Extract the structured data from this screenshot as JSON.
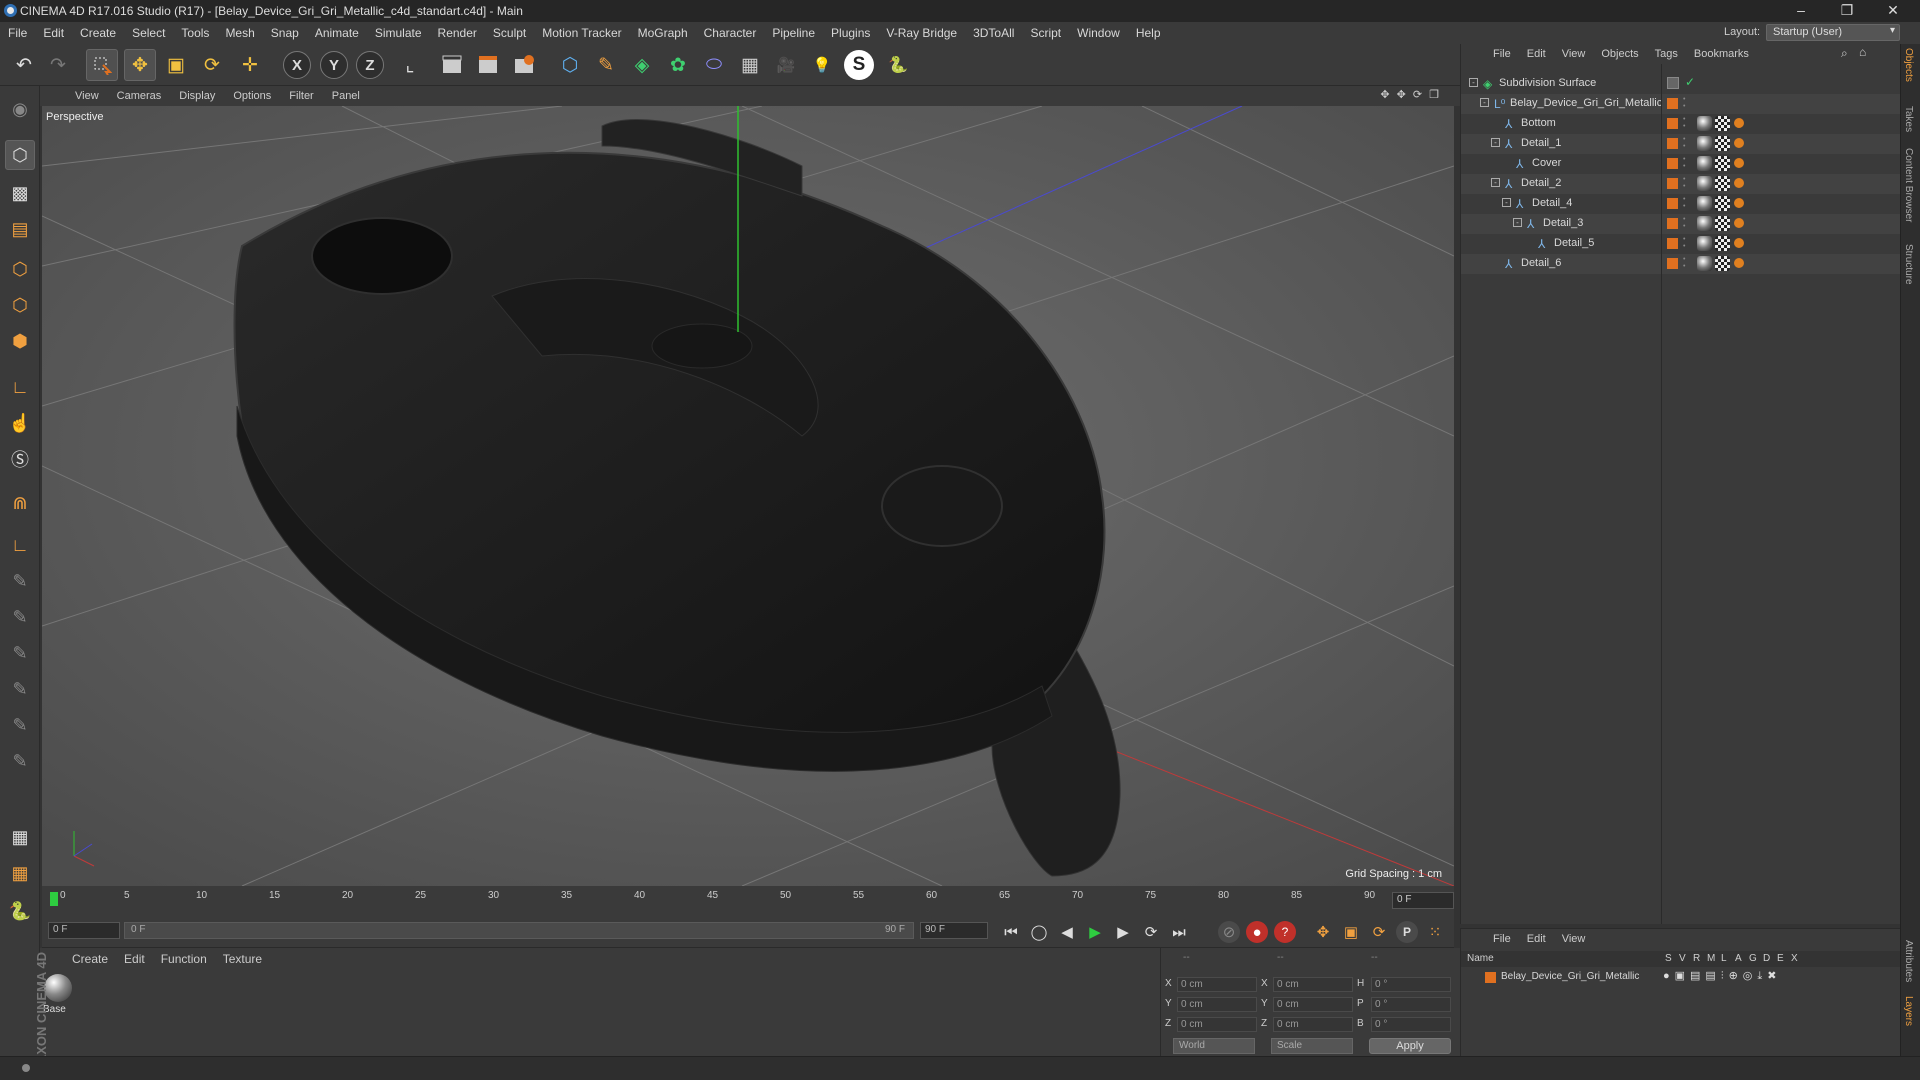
{
  "window": {
    "title": "CINEMA 4D R17.016 Studio (R17) - [Belay_Device_Gri_Gri_Metallic_c4d_standart.c4d] - Main",
    "controls": [
      "–",
      "❐",
      "✕"
    ]
  },
  "menu": [
    "File",
    "Edit",
    "Create",
    "Select",
    "Tools",
    "Mesh",
    "Snap",
    "Animate",
    "Simulate",
    "Render",
    "Sculpt",
    "Motion Tracker",
    "MoGraph",
    "Character",
    "Pipeline",
    "Plugins",
    "V-Ray Bridge",
    "3DToAll",
    "Script",
    "Window",
    "Help"
  ],
  "layout": {
    "label": "Layout:",
    "value": "Startup (User)"
  },
  "toolbar_icons": [
    "undo-icon",
    "redo-icon",
    "live-selection-icon",
    "move-icon",
    "scale-icon",
    "rotate-icon",
    "transform-icon",
    "x-axis-icon",
    "y-axis-icon",
    "z-axis-icon",
    "coordinate-system-icon",
    "render-view-icon",
    "render-picture-viewer-icon",
    "edit-render-settings-icon",
    "cube-icon",
    "pen-icon",
    "subdivision-surface-icon",
    "array-icon",
    "deformer-icon",
    "floor-icon",
    "camera-icon",
    "light-icon",
    "vray-icon",
    "python-icon"
  ],
  "toolbar_glyphs": {
    "undo": "↶",
    "redo": "↷",
    "move": "✥",
    "scale": "▣",
    "rotate": "⟳",
    "transform": "✛",
    "x": "X",
    "y": "Y",
    "z": "Z",
    "coord": "⌞",
    "render": "🎬",
    "cube": "⬡",
    "pen": "✎",
    "subdiv": "◈",
    "array": "✿",
    "deform": "⬭",
    "floor": "▦",
    "camera": "🎥",
    "light": "💡",
    "vray": "S",
    "python": "🐍"
  },
  "left_tools": [
    "make-editable-icon",
    "model-mode-icon",
    "texture-mode-icon",
    "workplane-icon",
    "points-mode-icon",
    "edges-mode-icon",
    "polygons-mode-icon",
    "axis-icon",
    "tweak-icon",
    "solo-icon",
    "magnet-icon",
    "snap-icon",
    "brush-icon",
    "paint-icon",
    "smooth-icon",
    "knife-icon",
    "grab-icon",
    "iron-icon",
    "lock-workplane-icon",
    "floor-grid-icon",
    "python-icon"
  ],
  "viewport": {
    "menu": [
      "View",
      "Cameras",
      "Display",
      "Options",
      "Filter",
      "Panel"
    ],
    "label": "Perspective",
    "grid_spacing": "Grid Spacing : 1 cm",
    "nav_icons": "✥ ✥ ⟳ ❐"
  },
  "timeline": {
    "ticks": [
      "0",
      "5",
      "10",
      "15",
      "20",
      "25",
      "30",
      "35",
      "40",
      "45",
      "50",
      "55",
      "60",
      "65",
      "70",
      "75",
      "80",
      "85",
      "90"
    ],
    "current_frame": "0 F",
    "start_field": "0 F",
    "range_start": "0 F",
    "range_end": "90 F",
    "end_field": "90 F"
  },
  "playback": [
    "⏮",
    "◯",
    "◀",
    "▶",
    "▶",
    "⟳",
    "⏭"
  ],
  "material_panel": {
    "menu": [
      "Create",
      "Edit",
      "Function",
      "Texture"
    ],
    "material": "Base"
  },
  "branding": "MAXON CINEMA 4D",
  "coordinates": {
    "header": [
      "--",
      "--",
      "--"
    ],
    "rows": [
      {
        "a": "X",
        "a_val": "0 cm",
        "b": "X",
        "b_val": "0 cm",
        "c": "H",
        "c_val": "0 °"
      },
      {
        "a": "Y",
        "a_val": "0 cm",
        "b": "Y",
        "b_val": "0 cm",
        "c": "P",
        "c_val": "0 °"
      },
      {
        "a": "Z",
        "a_val": "0 cm",
        "b": "Z",
        "b_val": "0 cm",
        "c": "B",
        "c_val": "0 °"
      }
    ],
    "mode": "World",
    "transform": "Scale",
    "apply": "Apply"
  },
  "objects_panel": {
    "menu": [
      "File",
      "Edit",
      "View",
      "Objects",
      "Tags",
      "Bookmarks"
    ],
    "items": [
      {
        "name": "Subdivision Surface",
        "level": 0,
        "expand": "-",
        "tags": 0
      },
      {
        "name": "Belay_Device_Gri_Gri_Metallic",
        "level": 1,
        "expand": "-",
        "tags": 0
      },
      {
        "name": "Bottom",
        "level": 2,
        "expand": "",
        "tags": 3
      },
      {
        "name": "Detail_1",
        "level": 2,
        "expand": "-",
        "tags": 3
      },
      {
        "name": "Cover",
        "level": 3,
        "expand": "",
        "tags": 3
      },
      {
        "name": "Detail_2",
        "level": 2,
        "expand": "-",
        "tags": 3
      },
      {
        "name": "Detail_4",
        "level": 3,
        "expand": "-",
        "tags": 3
      },
      {
        "name": "Detail_3",
        "level": 4,
        "expand": "-",
        "tags": 3
      },
      {
        "name": "Detail_5",
        "level": 5,
        "expand": "",
        "tags": 3
      },
      {
        "name": "Detail_6",
        "level": 2,
        "expand": "",
        "tags": 3
      }
    ]
  },
  "attributes_panel": {
    "menu": [
      "File",
      "Edit",
      "View"
    ],
    "columns": [
      "Name",
      "S",
      "V",
      "R",
      "M",
      "L",
      "A",
      "G",
      "D",
      "E",
      "X"
    ],
    "item": "Belay_Device_Gri_Gri_Metallic"
  },
  "right_tabs": [
    "Objects",
    "Takes",
    "Content Browser",
    "Structure",
    "Attributes",
    "Layers"
  ],
  "colors": {
    "accent_orange": "#e07020",
    "axis_x": "#c03a3a",
    "axis_y": "#2fbf2f",
    "axis_z": "#4a4ad0",
    "object_icon": "#7fb6e8",
    "current_frame": "#2ecc40"
  }
}
